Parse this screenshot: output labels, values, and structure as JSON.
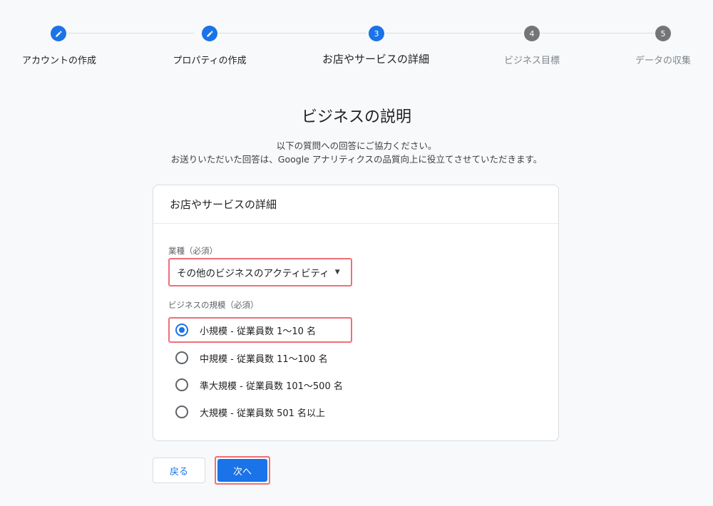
{
  "stepper": {
    "steps": [
      {
        "number": "",
        "label": "アカウントの作成",
        "state": "done",
        "icon": "pencil-icon"
      },
      {
        "number": "",
        "label": "プロパティの作成",
        "state": "done",
        "icon": "pencil-icon"
      },
      {
        "number": "3",
        "label": "お店やサービスの詳細",
        "state": "active"
      },
      {
        "number": "4",
        "label": "ビジネス目標",
        "state": "pending"
      },
      {
        "number": "5",
        "label": "データの収集",
        "state": "pending"
      }
    ]
  },
  "page": {
    "title": "ビジネスの説明",
    "desc_line1": "以下の質問への回答にご協力ください。",
    "desc_line2": "お送りいただいた回答は、Google アナリティクスの品質向上に役立てさせていただきます。"
  },
  "card": {
    "header": "お店やサービスの詳細",
    "industry_label": "業種（必須）",
    "industry_value": "その他のビジネスのアクティビティ",
    "size_label": "ビジネスの規模（必須）",
    "size_options": [
      {
        "label": "小規模 - 従業員数 1〜10 名",
        "checked": true
      },
      {
        "label": "中規模 - 従業員数 11〜100 名",
        "checked": false
      },
      {
        "label": "準大規模 - 従業員数 101〜500 名",
        "checked": false
      },
      {
        "label": "大規模 - 従業員数 501 名以上",
        "checked": false
      }
    ]
  },
  "buttons": {
    "back": "戻る",
    "next": "次へ"
  },
  "colors": {
    "accent": "#1a73e8",
    "highlight": "#ef6f79",
    "pending": "#757575"
  }
}
